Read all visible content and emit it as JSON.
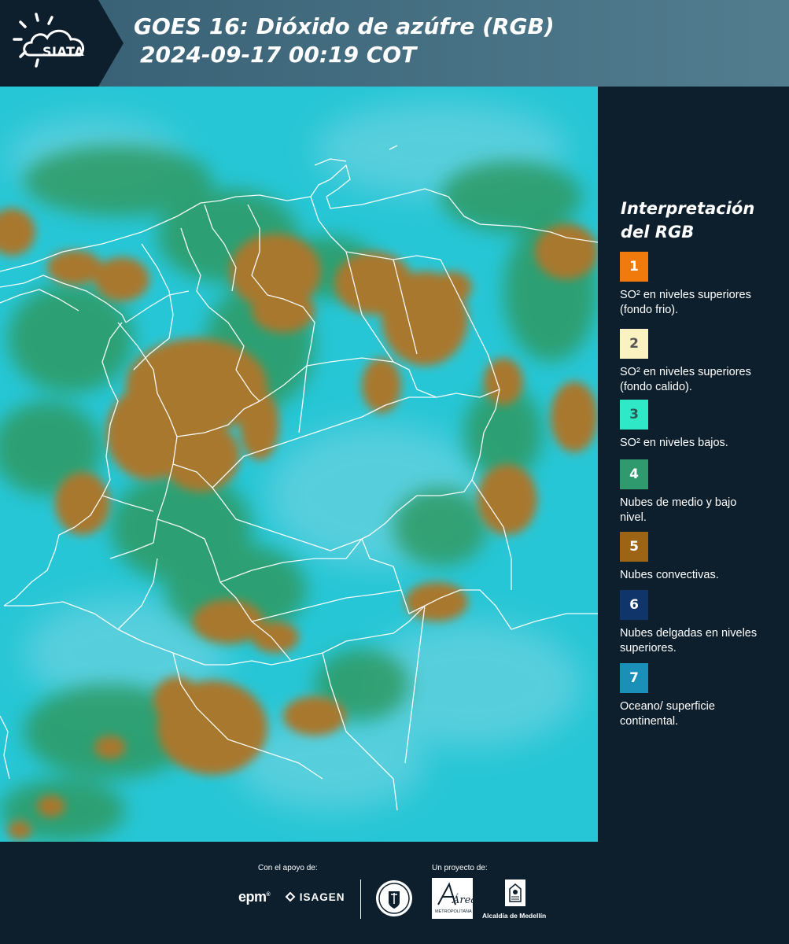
{
  "header": {
    "logo_text": "SIATA",
    "title_line1": "GOES 16: Dióxido de azúfre (RGB)",
    "title_line2": "2024-09-17 00:19 COT"
  },
  "legend": {
    "title": "Interpretación del RGB",
    "items": [
      {
        "number": "1",
        "color": "#f07a0c",
        "label": "SO² en niveles superiores (fondo frio)."
      },
      {
        "number": "2",
        "color": "#fbf2c2",
        "label": "SO² en niveles superiores (fondo calido)."
      },
      {
        "number": "3",
        "color": "#2fe8c6",
        "label": "SO² en niveles bajos."
      },
      {
        "number": "4",
        "color": "#2e9a6d",
        "label": "Nubes de medio y bajo nivel."
      },
      {
        "number": "5",
        "color": "#9c6414",
        "label": "Nubes convectivas."
      },
      {
        "number": "6",
        "color": "#0f356a",
        "label": "Nubes delgadas en niveles superiores."
      },
      {
        "number": "7",
        "color": "#1a8fb8",
        "label": "Oceano/ superficie continental."
      }
    ]
  },
  "footer": {
    "support_label": "Con el apoyo de:",
    "project_label": "Un proyecto de:",
    "epm": "epm",
    "isagen": "ISAGEN",
    "metro_text": "Área",
    "metro_sub": "METROPOLITANA",
    "alcaldia": "Alcaldía de Medellín"
  },
  "colors": {
    "background": "#0d1f2d",
    "header_band": "#4a7587",
    "ocean": "#27c6d6",
    "cloud_convective": "#a8782e",
    "cloud_mid_low": "#2f9a64"
  }
}
